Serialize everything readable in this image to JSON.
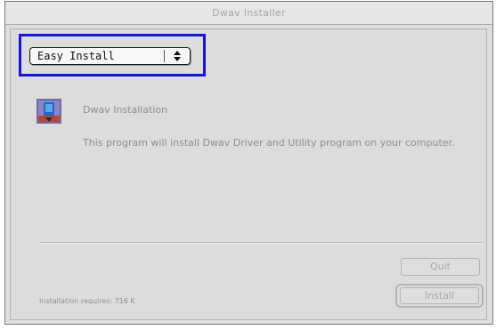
{
  "window": {
    "title": "Dwav Installer"
  },
  "install_type": {
    "selected": "Easy Install"
  },
  "product": {
    "icon": "installer-app-icon",
    "title": "Dwav Installation",
    "description": "This program will install Dwav Driver and Utility program on your computer."
  },
  "requirements": {
    "text": "Installation requires: 716 K"
  },
  "buttons": {
    "quit": "Quit",
    "install": "Install"
  },
  "colors": {
    "highlight": "#1515e0"
  }
}
